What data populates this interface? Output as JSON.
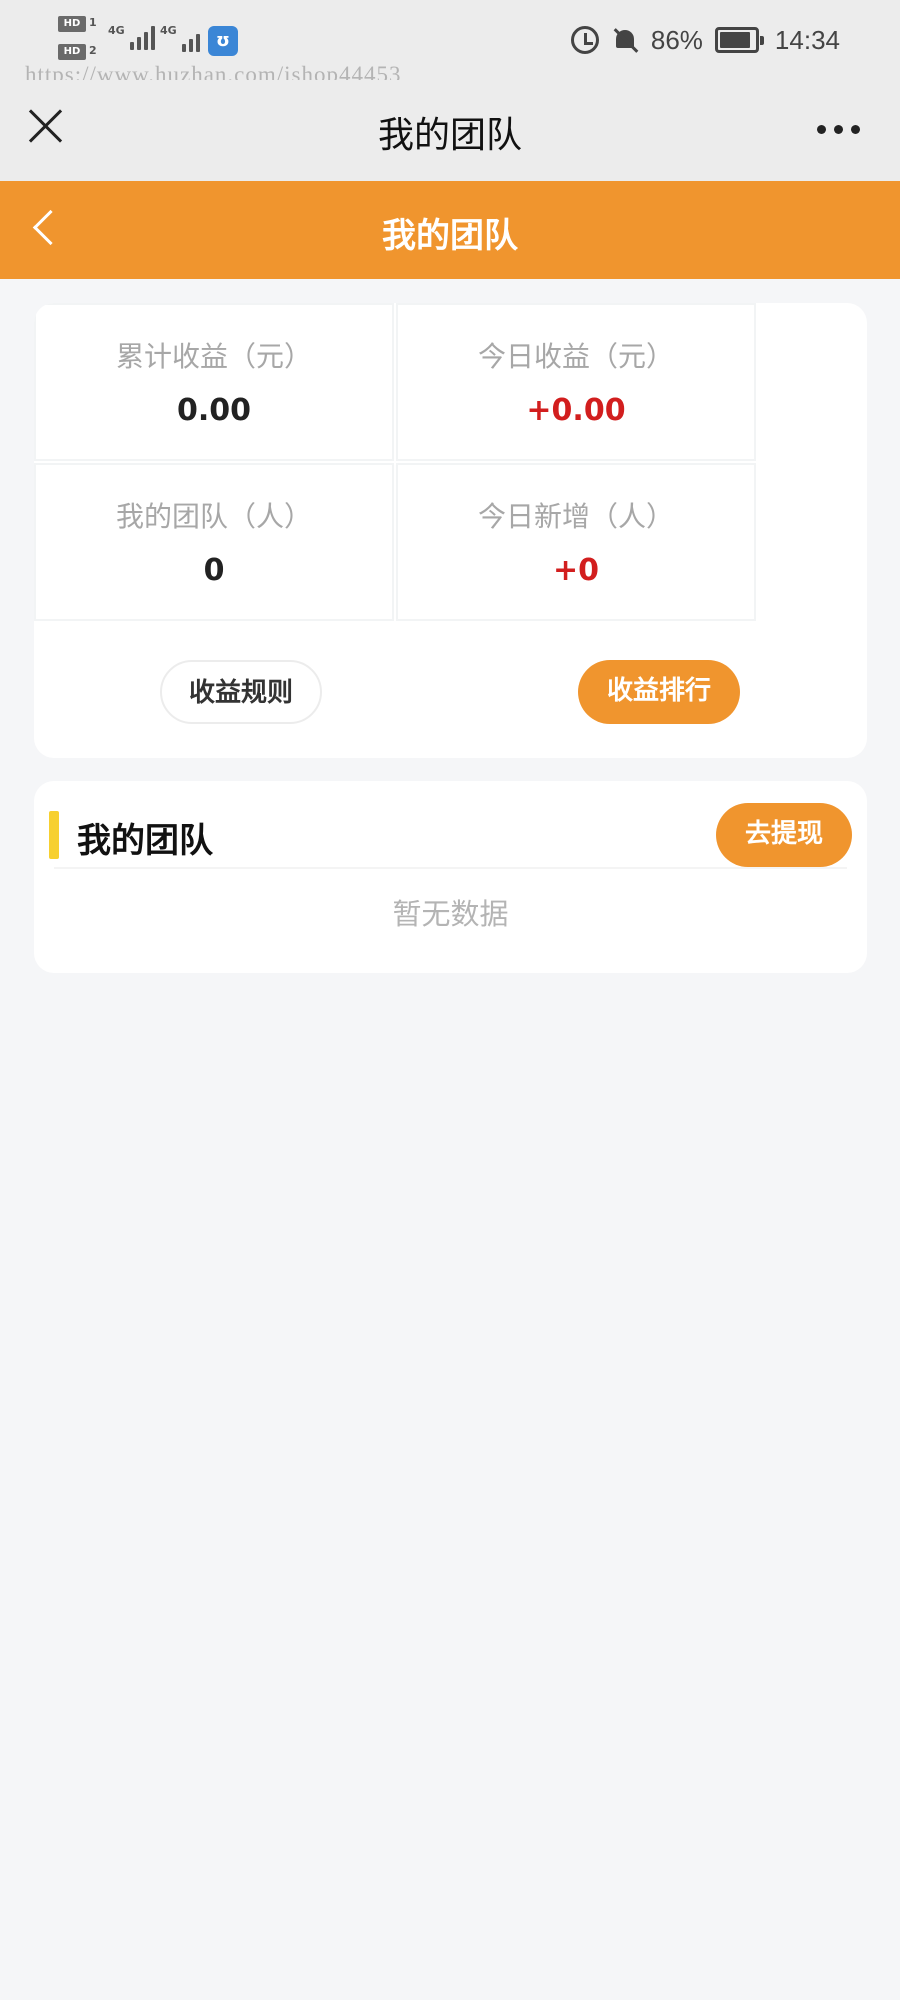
{
  "status_bar": {
    "sim1_badge": "HD",
    "sim1_num": "1",
    "sim2_badge": "HD",
    "sim2_num": "2",
    "net1": "4G",
    "net2": "4G",
    "battery_percent": "86%",
    "time": "14:34",
    "icons": [
      "alarm-icon",
      "bell-off-icon",
      "battery-icon"
    ]
  },
  "watermark": "https://www.huzhan.com/ishop44453",
  "wechat_header": {
    "title": "我的团队",
    "close_icon": "close-icon",
    "more_icon": "more-icon"
  },
  "page_header": {
    "title": "我的团队",
    "back_icon": "back-chevron-icon",
    "background": "#f0952e"
  },
  "stats": [
    {
      "label": "累计收益（元）",
      "value": "0.00",
      "highlight": false
    },
    {
      "label": "今日收益（元）",
      "value": "+0.00",
      "highlight": true
    },
    {
      "label": "我的团队（人）",
      "value": "0",
      "highlight": false
    },
    {
      "label": "今日新增（人）",
      "value": "+0",
      "highlight": true
    }
  ],
  "buttons": {
    "rules": "收益规则",
    "ranking": "收益排行"
  },
  "team_section": {
    "title": "我的团队",
    "withdraw_button": "去提现",
    "empty_text": "暂无数据",
    "accent_color": "#f7d030"
  },
  "colors": {
    "accent_orange": "#f0952e",
    "value_red": "#d21e1e",
    "page_bg": "#f5f6f8"
  }
}
